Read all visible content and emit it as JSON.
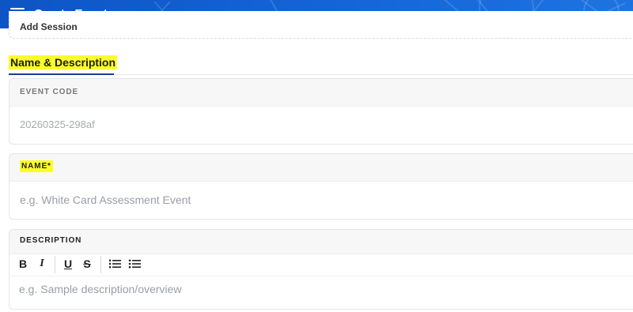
{
  "header": {
    "title": "Create Event",
    "menu_icon": "hamburger-menu-icon",
    "color": "#1565d8"
  },
  "add_session": {
    "label": "Add Session"
  },
  "section": {
    "title": "Name & Description",
    "highlight_color": "#fcfc2c"
  },
  "fields": {
    "event_code": {
      "label": "EVENT CODE",
      "value": "20260325-298af"
    },
    "name": {
      "label": "NAME*",
      "placeholder": "e.g. White Card Assessment Event",
      "value": ""
    },
    "description": {
      "label": "DESCRIPTION",
      "placeholder": "e.g. Sample description/overview"
    }
  },
  "toolbar": {
    "bold": "B",
    "italic": "I",
    "underline": "U",
    "strike": "S",
    "icons": [
      "bold-icon",
      "italic-icon",
      "underline-icon",
      "strikethrough-icon",
      "ordered-list-icon",
      "bullet-list-icon"
    ]
  }
}
